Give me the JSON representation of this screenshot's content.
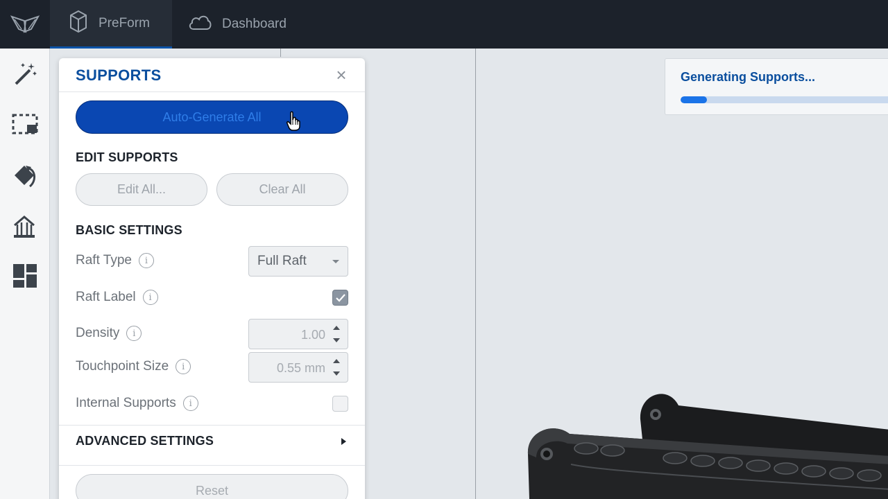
{
  "topbar": {
    "tabs": [
      {
        "label": "PreForm",
        "icon": "preform-cube-icon"
      },
      {
        "label": "Dashboard",
        "icon": "cloud-icon"
      }
    ]
  },
  "toolbar": {
    "tools": [
      "magic-wand-icon",
      "selection-icon",
      "orientation-icon",
      "supports-icon",
      "layout-icon"
    ]
  },
  "supports_panel": {
    "title": "SUPPORTS",
    "auto_generate_label": "Auto-Generate All",
    "edit_section_title": "EDIT SUPPORTS",
    "edit_all_label": "Edit All...",
    "clear_all_label": "Clear All",
    "basic_section_title": "BASIC SETTINGS",
    "raft_type": {
      "label": "Raft Type",
      "value": "Full Raft"
    },
    "raft_label": {
      "label": "Raft Label",
      "checked": true
    },
    "density": {
      "label": "Density",
      "value": "1.00"
    },
    "touchpoint_size": {
      "label": "Touchpoint Size",
      "value": "0.55 mm"
    },
    "internal_supports": {
      "label": "Internal Supports",
      "checked": false
    },
    "advanced_section_title": "ADVANCED SETTINGS",
    "reset_label": "Reset"
  },
  "progress": {
    "title": "Generating Supports...",
    "fraction": 0.12
  },
  "colors": {
    "accent": "#0a47b2",
    "title_blue": "#0a4e9e",
    "topbar": "#1c222b"
  }
}
